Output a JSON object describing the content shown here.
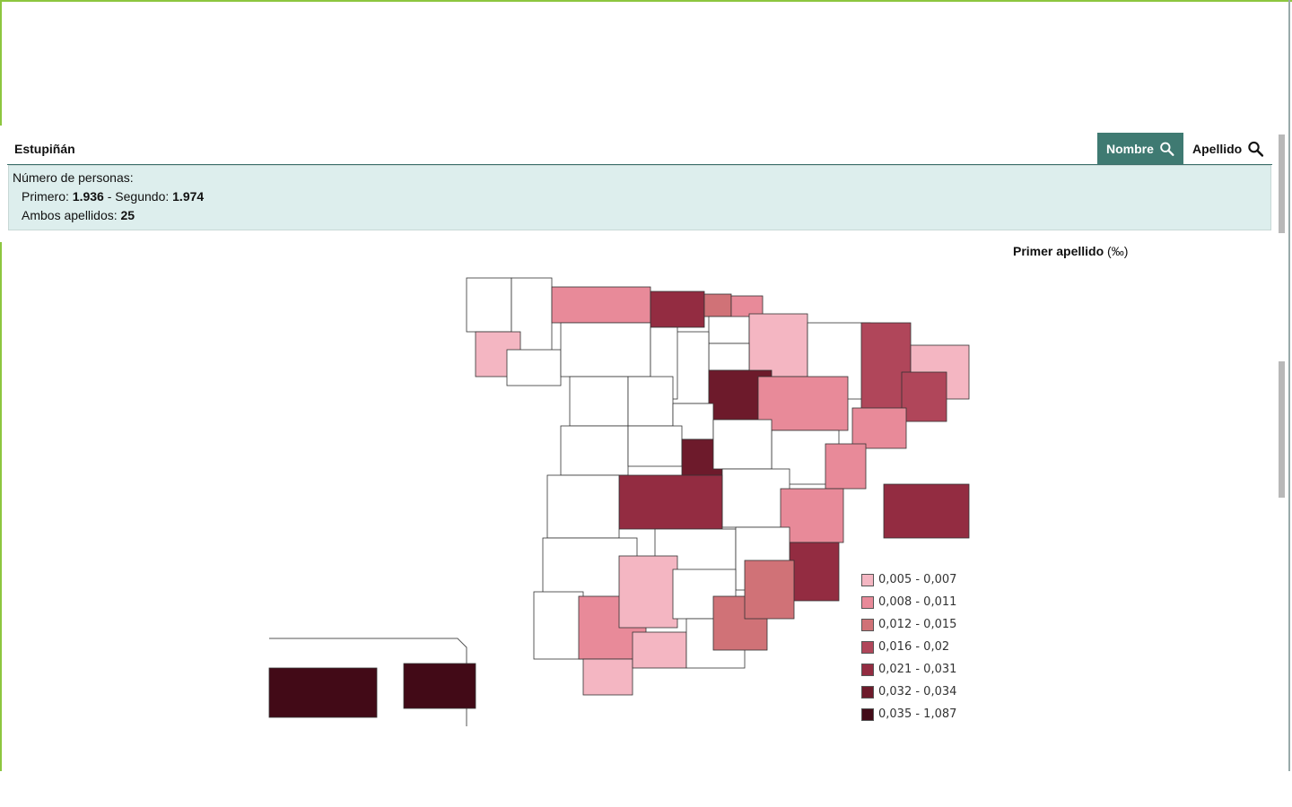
{
  "header": {
    "surname": "Estupiñán",
    "name_button": "Nombre",
    "surname_button": "Apellido"
  },
  "info": {
    "title": "Número de personas:",
    "first_label": "Primero:",
    "first_value": "1.936",
    "second_label": "Segundo:",
    "second_value": "1.974",
    "both_label": "Ambos apellidos:",
    "both_value": "25",
    "separator": "-"
  },
  "map": {
    "title": "Primer apellido",
    "unit": "(‰)",
    "legend": [
      {
        "label": "0,005 - 0,007",
        "color": "#f4b6c2"
      },
      {
        "label": "0,008 - 0,011",
        "color": "#e88a99"
      },
      {
        "label": "0,012 - 0,015",
        "color": "#d07277"
      },
      {
        "label": "0,016 - 0,02",
        "color": "#b0465a"
      },
      {
        "label": "0,021 - 0,031",
        "color": "#932c41"
      },
      {
        "label": "0,032 - 0,034",
        "color": "#6d1a2b"
      },
      {
        "label": "0,035 - 1,087",
        "color": "#420a17"
      }
    ],
    "colors": {
      "none": "#ffffff",
      "stroke": "#333333"
    },
    "provinces": {
      "A Coruña": null,
      "Lugo": null,
      "Pontevedra": 0,
      "Ourense": null,
      "Asturias": 1,
      "Cantabria": 4,
      "Bizkaia": 2,
      "Gipuzkoa": 1,
      "Araba": null,
      "Navarra": 0,
      "La Rioja": null,
      "Burgos": null,
      "Soria": 5,
      "León": null,
      "Palencia": null,
      "Zamora": null,
      "Valladolid": null,
      "Salamanca": null,
      "Segovia": null,
      "Ávila": null,
      "Huesca": null,
      "Zaragoza": 1,
      "Teruel": null,
      "Lleida": 3,
      "Girona": 0,
      "Barcelona": 3,
      "Tarragona": 1,
      "Madrid": 5,
      "Guadalajara": null,
      "Cuenca": null,
      "Toledo": 4,
      "Ciudad Real": null,
      "Castellón": 1,
      "Valencia": 1,
      "Alicante": 4,
      "Albacete": null,
      "Cáceres": null,
      "Badajoz": null,
      "Huelva": null,
      "Sevilla": 1,
      "Córdoba": 0,
      "Jaén": null,
      "Cádiz": 0,
      "Málaga": 0,
      "Granada": null,
      "Almería": 2,
      "Murcia": 2,
      "Illes Balears": 4,
      "Las Palmas": 6,
      "Santa Cruz de Tenerife": 6
    }
  }
}
